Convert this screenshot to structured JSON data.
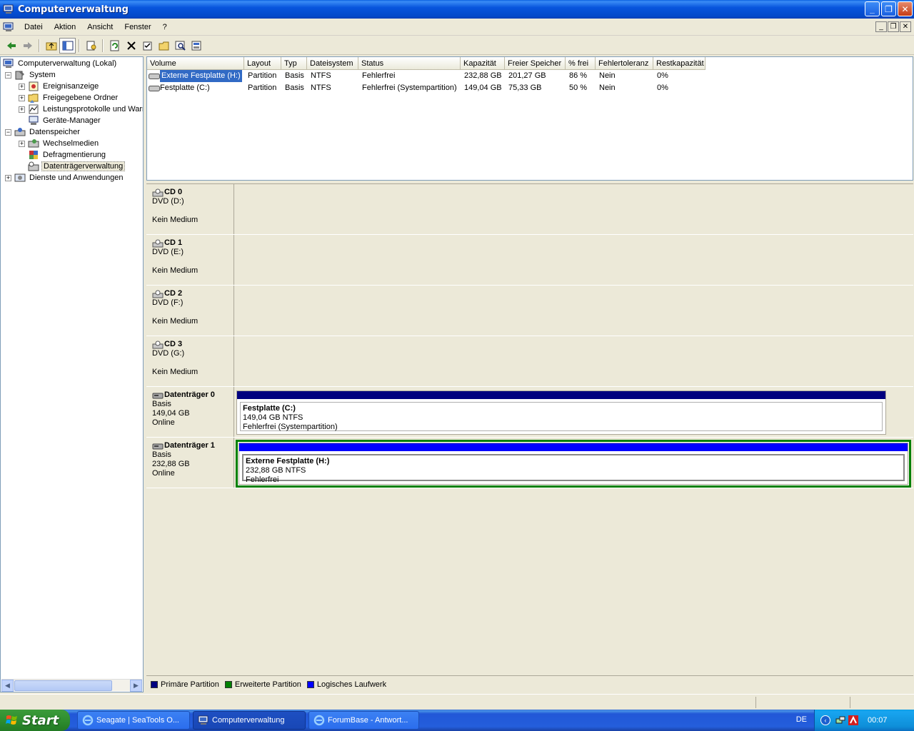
{
  "window": {
    "title": "Computerverwaltung"
  },
  "menu": {
    "items": [
      "Datei",
      "Aktion",
      "Ansicht",
      "Fenster",
      "?"
    ]
  },
  "tree": {
    "items": [
      {
        "label": "Computerverwaltung (Lokal)",
        "level": 0,
        "expander": "",
        "icon": "computer-icon"
      },
      {
        "label": "System",
        "level": 1,
        "expander": "−",
        "icon": "system-tools-icon"
      },
      {
        "label": "Ereignisanzeige",
        "level": 2,
        "expander": "+",
        "icon": "event-viewer-icon"
      },
      {
        "label": "Freigegebene Ordner",
        "level": 2,
        "expander": "+",
        "icon": "shared-folder-icon"
      },
      {
        "label": "Leistungsprotokolle und Warn",
        "level": 2,
        "expander": "+",
        "icon": "performance-icon"
      },
      {
        "label": "Geräte-Manager",
        "level": 2,
        "expander": "",
        "icon": "device-manager-icon"
      },
      {
        "label": "Datenspeicher",
        "level": 1,
        "expander": "−",
        "icon": "storage-icon"
      },
      {
        "label": "Wechselmedien",
        "level": 2,
        "expander": "+",
        "icon": "removable-media-icon"
      },
      {
        "label": "Defragmentierung",
        "level": 2,
        "expander": "",
        "icon": "defrag-icon"
      },
      {
        "label": "Datenträgerverwaltung",
        "level": 2,
        "expander": "",
        "icon": "disk-management-icon",
        "selected": true
      },
      {
        "label": "Dienste und Anwendungen",
        "level": 1,
        "expander": "+",
        "icon": "services-icon"
      }
    ]
  },
  "volume_list": {
    "columns": [
      "Volume",
      "Layout",
      "Typ",
      "Dateisystem",
      "Status",
      "Kapazität",
      "Freier Speicher",
      "% frei",
      "Fehlertoleranz",
      "Restkapazität"
    ],
    "rows": [
      [
        "Externe Festplatte (H:)",
        "Partition",
        "Basis",
        "NTFS",
        "Fehlerfrei",
        "232,88 GB",
        "201,27 GB",
        "86 %",
        "Nein",
        "0%"
      ],
      [
        "Festplatte (C:)",
        "Partition",
        "Basis",
        "NTFS",
        "Fehlerfrei (Systempartition)",
        "149,04 GB",
        "75,33 GB",
        "50 %",
        "Nein",
        "0%"
      ]
    ]
  },
  "disks": [
    {
      "name": "CD 0",
      "line1": "DVD (D:)",
      "line2": "",
      "line3": "Kein Medium"
    },
    {
      "name": "CD 1",
      "line1": "DVD (E:)",
      "line2": "",
      "line3": "Kein Medium"
    },
    {
      "name": "CD 2",
      "line1": "DVD (F:)",
      "line2": "",
      "line3": "Kein Medium"
    },
    {
      "name": "CD 3",
      "line1": "DVD (G:)",
      "line2": "",
      "line3": "Kein Medium"
    },
    {
      "name": "Datenträger 0",
      "line1": "Basis",
      "line2": "149,04 GB",
      "line3": "Online",
      "partition": {
        "name": "Festplatte  (C:)",
        "size": "149,04 GB NTFS",
        "status": "Fehlerfrei (Systempartition)",
        "bar_color": "#00007f"
      }
    },
    {
      "name": "Datenträger 1",
      "line1": "Basis",
      "line2": "232,88 GB",
      "line3": "Online",
      "partition": {
        "name": "Externe Festplatte  (H:)",
        "size": "232,88 GB NTFS",
        "status": "Fehlerfrei",
        "bar_color": "#0000ff",
        "frame_color": "#008000"
      }
    }
  ],
  "legend": {
    "items": [
      {
        "label": "Primäre Partition",
        "color": "#00007f"
      },
      {
        "label": "Erweiterte Partition",
        "color": "#008000"
      },
      {
        "label": "Logisches Laufwerk",
        "color": "#0000ff"
      }
    ]
  },
  "taskbar": {
    "start_label": "Start",
    "tasks": [
      "Seagate | SeaTools O...",
      "Computerverwaltung",
      "ForumBase - Antwort..."
    ],
    "language": "DE",
    "clock": "00:07"
  }
}
